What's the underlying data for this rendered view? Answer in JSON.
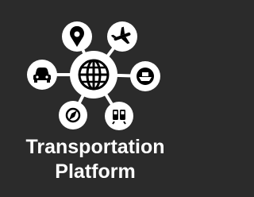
{
  "caption": {
    "line1": "Transportation",
    "line2": "Platform"
  },
  "icons": {
    "center": "globe-icon",
    "nodes": [
      "location-pin-icon",
      "airplane-icon",
      "car-icon",
      "ship-icon",
      "compass-icon",
      "train-icon"
    ]
  },
  "colors": {
    "background": "#2b2b2b",
    "foreground": "#ffffff",
    "icon_glyph": "#000000"
  }
}
